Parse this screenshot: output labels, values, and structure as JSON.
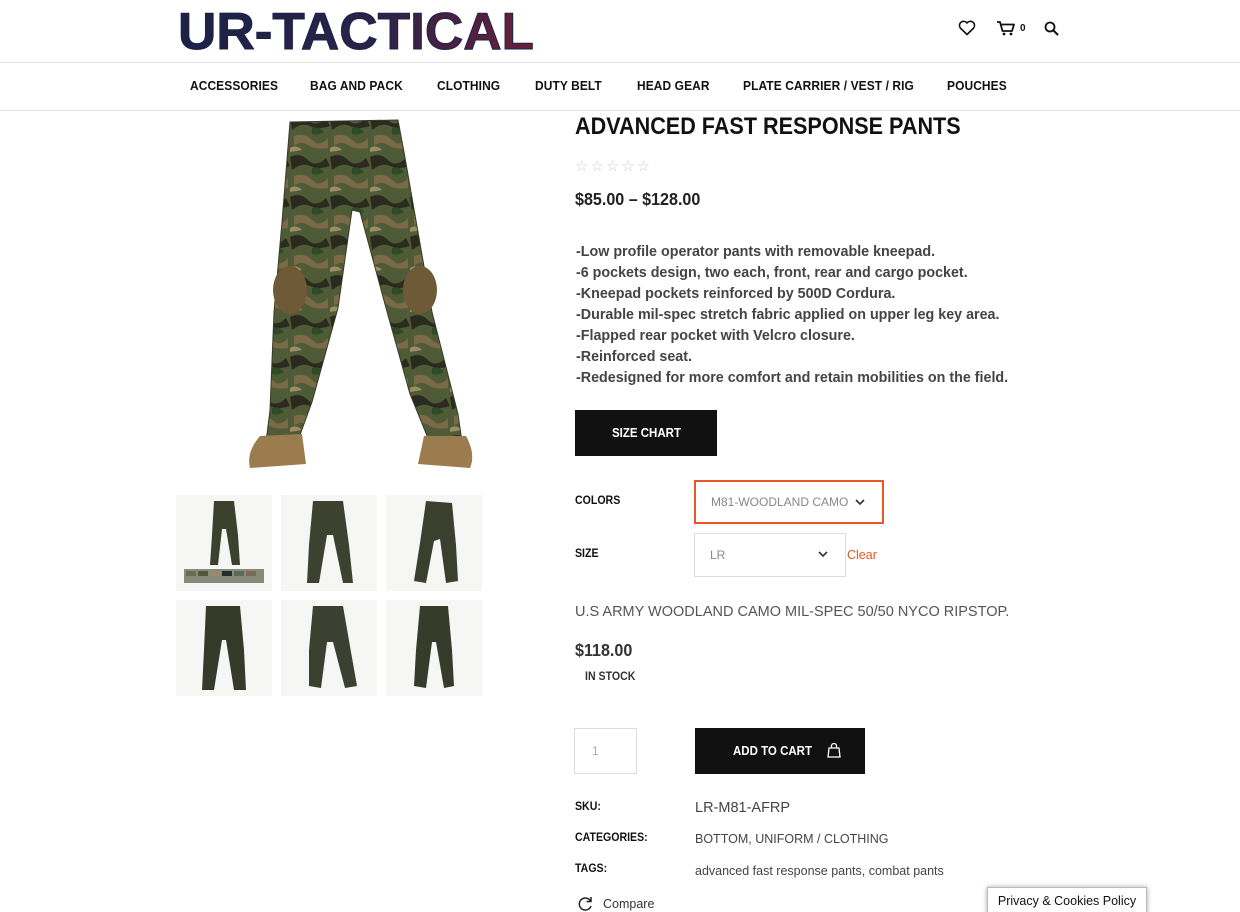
{
  "brand": {
    "logo_text": "UR-TACTICAL"
  },
  "header": {
    "cart_count": "0",
    "icons": [
      "heart-icon",
      "cart-icon",
      "search-icon"
    ]
  },
  "nav": {
    "items": [
      {
        "label": "ACCESSORIES"
      },
      {
        "label": "BAG AND PACK"
      },
      {
        "label": "CLOTHING"
      },
      {
        "label": "DUTY BELT"
      },
      {
        "label": "HEAD GEAR"
      },
      {
        "label": "PLATE CARRIER / VEST / RIG"
      },
      {
        "label": "POUCHES"
      }
    ]
  },
  "product": {
    "title": "ADVANCED FAST RESPONSE PANTS",
    "rating_stars": "☆☆☆☆☆",
    "price_range": "$85.00 – $128.00",
    "description": [
      "-Low profile operator pants with removable kneepad.",
      "-6 pockets design, two each, front, rear and cargo pocket.",
      "-Kneepad pockets reinforced by 500D Cordura.",
      "-Durable mil-spec stretch fabric applied on upper leg key area.",
      "-Flapped rear pocket with Velcro closure.",
      "-Reinforced seat.",
      "-Redesigned for more comfort and retain mobilities on the field."
    ],
    "size_chart_label": "SIZE CHART",
    "variations": {
      "colors_label": "COLORS",
      "colors_value": "M81-WOODLAND CAMO",
      "size_label": "SIZE",
      "size_value": "LR",
      "clear_label": "Clear"
    },
    "variant_description": "U.S ARMY WOODLAND CAMO MIL-SPEC 50/50 NYCO RIPSTOP.",
    "variant_price": "$118.00",
    "stock_status": "IN STOCK",
    "quantity": "1",
    "add_to_cart_label": "ADD TO CART",
    "meta": {
      "sku_label": "SKU:",
      "sku_value": "LR-M81-AFRP",
      "categories_label": "CATEGORIES:",
      "categories": [
        "BOTTOM",
        "UNIFORM / CLOTHING"
      ],
      "tags_label": "TAGS:",
      "tags": [
        "advanced fast response pants",
        "combat pants"
      ]
    },
    "compare_label": "Compare"
  },
  "colors": {
    "accent": "#e8562a",
    "button_bg": "#111111",
    "logo_navy": "#1c2247",
    "logo_red": "#b5182a"
  },
  "cookie_banner": {
    "label": "Privacy & Cookies Policy"
  }
}
